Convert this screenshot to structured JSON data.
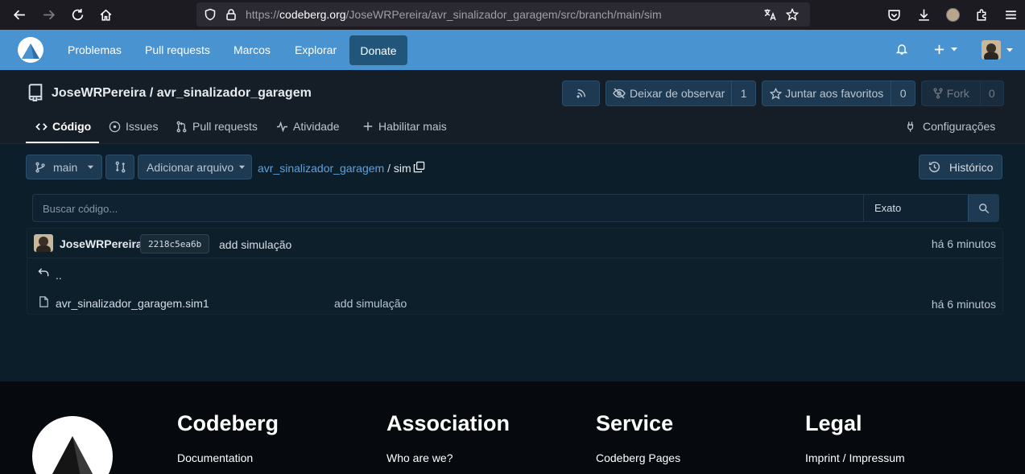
{
  "browser": {
    "url_prefix": "https://",
    "url_domain": "codeberg.org",
    "url_path": "/JoseWRPereira/avr_sinalizador_garagem/src/branch/main/sim"
  },
  "nav": {
    "items": [
      "Problemas",
      "Pull requests",
      "Marcos",
      "Explorar"
    ],
    "donate": "Donate"
  },
  "repo": {
    "title": "JoseWRPereira / avr_sinalizador_garagem",
    "unwatch_label": "Deixar de observar",
    "unwatch_count": "1",
    "star_label": "Juntar aos favoritos",
    "star_count": "0",
    "fork_label": "Fork",
    "fork_count": "0",
    "tabs": [
      "Código",
      "Issues",
      "Pull requests",
      "Atividade",
      "Habilitar mais"
    ],
    "settings": "Configurações"
  },
  "toolbar": {
    "branch": "main",
    "add_file": "Adicionar arquivo",
    "crumb_repo": "avr_sinalizador_garagem",
    "crumb_sep": " / ",
    "crumb_dir": "sim",
    "history": "Histórico"
  },
  "search": {
    "placeholder": "Buscar código...",
    "mode": "Exato"
  },
  "latest_commit": {
    "author": "JoseWRPereira",
    "sha": "2218c5ea6b",
    "message": "add simulação",
    "time": "há 6 minutos"
  },
  "files": {
    "parent": "..",
    "rows": [
      {
        "name": "avr_sinalizador_garagem.sim1",
        "message": "add simulação",
        "time": "há 6 minutos"
      }
    ]
  },
  "footer": {
    "columns": [
      {
        "title": "Codeberg",
        "link": "Documentation"
      },
      {
        "title": "Association",
        "link": "Who are we?"
      },
      {
        "title": "Service",
        "link": "Codeberg Pages"
      },
      {
        "title": "Legal",
        "link": "Imprint / Impressum"
      }
    ]
  }
}
